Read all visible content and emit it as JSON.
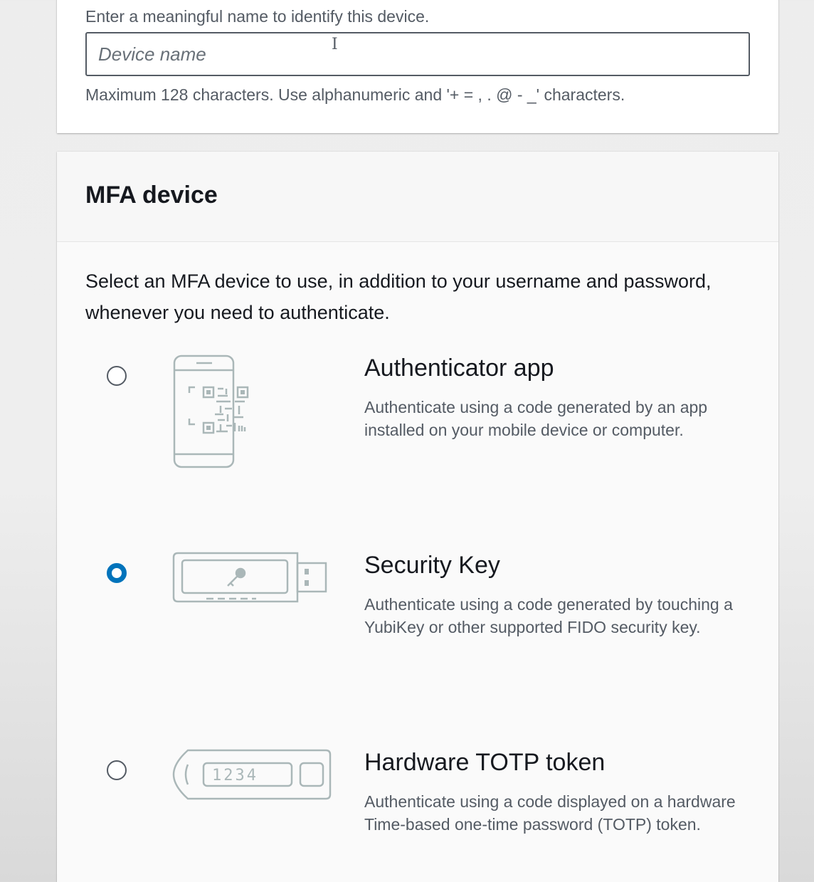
{
  "device_name_section": {
    "hint": "Enter a meaningful name to identify this device.",
    "input_placeholder": "Device name",
    "input_value": "",
    "constraint": "Maximum 128 characters. Use alphanumeric and '+ = , . @ - _' characters."
  },
  "mfa_section": {
    "title": "MFA device",
    "description": "Select an MFA device to use, in addition to your username and password, whenever you need to authenticate.",
    "selected_option": "security_key",
    "options": [
      {
        "id": "authenticator_app",
        "title": "Authenticator app",
        "description": "Authenticate using a code generated by an app installed on your mobile device or computer.",
        "icon": "phone-qr-icon",
        "selected": false
      },
      {
        "id": "security_key",
        "title": "Security Key",
        "description": "Authenticate using a code generated by touching a YubiKey or other supported FIDO security key.",
        "icon": "usb-key-icon",
        "selected": true
      },
      {
        "id": "hardware_totp",
        "title": "Hardware TOTP token",
        "description": "Authenticate using a code displayed on a hardware Time-based one-time password (TOTP) token.",
        "icon": "totp-token-icon",
        "token_display": "1234",
        "selected": false
      }
    ]
  },
  "colors": {
    "accent": "#0073bb",
    "text_primary": "#16191f",
    "text_secondary": "#545b64",
    "illustration_stroke": "#aab7b8"
  }
}
